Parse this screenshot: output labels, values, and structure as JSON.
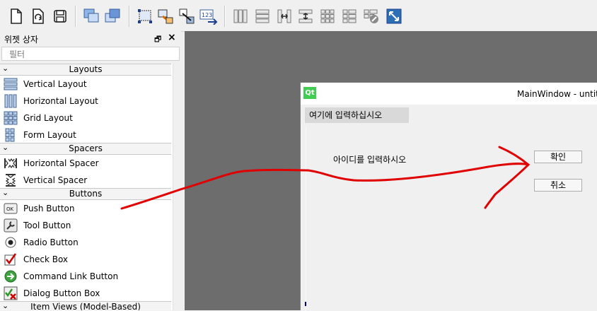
{
  "toolbar": {
    "buttons": [
      "new-file-icon",
      "open-file-icon",
      "save-icon",
      "send-to-back-icon",
      "bring-to-front-icon",
      "edit-widgets-icon",
      "edit-signals-slots-icon",
      "edit-buddies-icon",
      "edit-tab-order-icon",
      "layout-horizontal-icon",
      "layout-vertical-icon",
      "layout-horizontal-splitter-icon",
      "layout-vertical-splitter-icon",
      "layout-grid-icon",
      "layout-form-icon",
      "break-layout-icon",
      "adjust-size-icon"
    ]
  },
  "widget_box": {
    "title": "위젯 상자",
    "filter_placeholder": "필터",
    "categories": {
      "layouts": "Layouts",
      "spacers": "Spacers",
      "buttons": "Buttons",
      "item_views": "Item Views (Model-Based)"
    },
    "items": {
      "vertical_layout": "Vertical Layout",
      "horizontal_layout": "Horizontal Layout",
      "grid_layout": "Grid Layout",
      "form_layout": "Form Layout",
      "horizontal_spacer": "Horizontal Spacer",
      "vertical_spacer": "Vertical Spacer",
      "push_button": "Push Button",
      "tool_button": "Tool Button",
      "radio_button": "Radio Button",
      "check_box": "Check Box",
      "command_link_button": "Command Link Button",
      "dialog_button_box": "Dialog Button Box"
    }
  },
  "form": {
    "logo": "Qt",
    "title": "MainWindow - untitle",
    "menu_placeholder": "여기에 입력하십시오",
    "label_text": "아이디를 입력하시오",
    "ok_button": "확인",
    "cancel_button": "취소"
  },
  "colors": {
    "annotation_stroke": "#e00000",
    "canvas_bg": "#6d6d6d",
    "qt_green": "#41cd52"
  }
}
